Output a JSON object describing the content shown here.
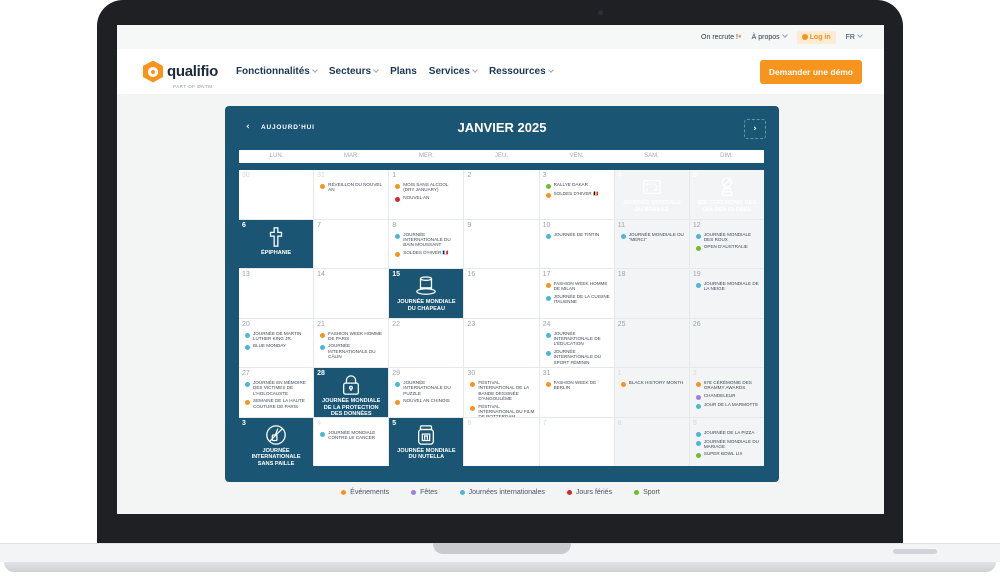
{
  "colors": {
    "evenements": "#f7941d",
    "fetes": "#9b7fe6",
    "journees": "#4ab7d8",
    "feries": "#d12b2b",
    "sport": "#6cbf2a"
  },
  "topbar": {
    "recruit": "On recrute !",
    "recruit_dot": "●",
    "about": "À propos",
    "login": "Log in",
    "lang": "FR"
  },
  "nav": {
    "logo": "qualifio",
    "logo_sub": "PART OF ØNTM",
    "items": [
      "Fonctionnalités",
      "Secteurs",
      "Plans",
      "Services",
      "Ressources"
    ],
    "cta": "Demander une démo"
  },
  "calendar": {
    "prev": "‹",
    "today": "AUJOURD'HUI",
    "month": "JANVIER 2025",
    "next": "›",
    "weekdays": [
      "LUN.",
      "MAR.",
      "MER.",
      "JEU.",
      "VEN.",
      "SAM.",
      "DIM."
    ],
    "days": [
      {
        "n": "30",
        "out": true,
        "events": []
      },
      {
        "n": "31",
        "out": true,
        "events": [
          {
            "t": "Réveillon du Nouvel An",
            "c": "evenements"
          }
        ]
      },
      {
        "n": "1",
        "events": [
          {
            "t": "Mois sans alcool (Dry January)",
            "c": "evenements"
          },
          {
            "t": "Nouvel An",
            "c": "feries"
          }
        ]
      },
      {
        "n": "2",
        "events": []
      },
      {
        "n": "3",
        "events": [
          {
            "t": "Rallye Dakar",
            "c": "sport"
          },
          {
            "t": "Soldes d'hiver 🇧🇪",
            "c": "evenements"
          }
        ]
      },
      {
        "n": "4",
        "featured": true,
        "icon": "braille-icon",
        "label": "Journée mondiale du braille"
      },
      {
        "n": "5",
        "featured": true,
        "icon": "golden-globe-icon",
        "label": "82e cérémonie des Golden Globes"
      },
      {
        "n": "6",
        "featured": true,
        "icon": "cross-icon",
        "label": "Épiphanie"
      },
      {
        "n": "7",
        "events": []
      },
      {
        "n": "8",
        "events": [
          {
            "t": "Journée internationale du bain moussant",
            "c": "journees"
          },
          {
            "t": "Soldes d'hiver 🇫🇷",
            "c": "evenements"
          }
        ]
      },
      {
        "n": "9",
        "events": []
      },
      {
        "n": "10",
        "events": [
          {
            "t": "Journée de Tintin",
            "c": "journees"
          }
        ]
      },
      {
        "n": "11",
        "events": [
          {
            "t": "Journée mondiale du \"merci\"",
            "c": "journees"
          }
        ]
      },
      {
        "n": "12",
        "events": [
          {
            "t": "Journée mondiale des roux",
            "c": "journees"
          },
          {
            "t": "Open d'Australie",
            "c": "sport"
          }
        ]
      },
      {
        "n": "13",
        "events": []
      },
      {
        "n": "14",
        "events": []
      },
      {
        "n": "15",
        "featured": true,
        "icon": "hat-icon",
        "label": "Journée mondiale du chapeau"
      },
      {
        "n": "16",
        "events": []
      },
      {
        "n": "17",
        "events": [
          {
            "t": "Fashion Week Homme de Milan",
            "c": "evenements"
          },
          {
            "t": "Journée de la cuisine italienne",
            "c": "journees"
          }
        ]
      },
      {
        "n": "18",
        "events": []
      },
      {
        "n": "19",
        "events": [
          {
            "t": "Journée mondiale de la neige",
            "c": "journees"
          }
        ]
      },
      {
        "n": "20",
        "events": [
          {
            "t": "Journée de Martin Luther King Jr.",
            "c": "journees"
          },
          {
            "t": "Blue Monday",
            "c": "journees"
          }
        ]
      },
      {
        "n": "21",
        "events": [
          {
            "t": "Fashion Week Homme de Paris",
            "c": "evenements"
          },
          {
            "t": "Journée internationale du câlin",
            "c": "journees"
          }
        ]
      },
      {
        "n": "22",
        "events": []
      },
      {
        "n": "23",
        "events": []
      },
      {
        "n": "24",
        "events": [
          {
            "t": "Journée internationale de l'éducation",
            "c": "journees"
          },
          {
            "t": "Journée internationale du sport féminin",
            "c": "journees"
          }
        ]
      },
      {
        "n": "25",
        "events": []
      },
      {
        "n": "26",
        "events": []
      },
      {
        "n": "27",
        "events": [
          {
            "t": "Journée en mémoire des victimes de l'Holocauste",
            "c": "journees"
          },
          {
            "t": "Semaine de la Haute Couture de Paris",
            "c": "evenements"
          }
        ]
      },
      {
        "n": "28",
        "featured": true,
        "icon": "padlock-icon",
        "label": "Journée mondiale de la protection des données"
      },
      {
        "n": "29",
        "events": [
          {
            "t": "Journée internationale du puzzle",
            "c": "journees"
          },
          {
            "t": "Nouvel An chinois",
            "c": "evenements"
          }
        ]
      },
      {
        "n": "30",
        "events": [
          {
            "t": "Festival international de la bande dessinée d'Angoulême",
            "c": "evenements"
          },
          {
            "t": "Festival international du film de Rotterdam",
            "c": "evenements"
          }
        ]
      },
      {
        "n": "31",
        "events": [
          {
            "t": "Fashion Week de Berlin",
            "c": "evenements"
          }
        ]
      },
      {
        "n": "1",
        "out": true,
        "events": [
          {
            "t": "Black History Month",
            "c": "evenements"
          }
        ]
      },
      {
        "n": "2",
        "out": true,
        "events": [
          {
            "t": "67e cérémonie des Grammy Awards",
            "c": "evenements"
          },
          {
            "t": "Chandeleur",
            "c": "fetes"
          },
          {
            "t": "Jour de la marmotte",
            "c": "journees"
          }
        ]
      },
      {
        "n": "3",
        "featured": true,
        "icon": "no-straw-icon",
        "label": "Journée internationale sans paille"
      },
      {
        "n": "4",
        "out": true,
        "events": [
          {
            "t": "Journée mondiale contre le cancer",
            "c": "journees"
          }
        ]
      },
      {
        "n": "5",
        "featured": true,
        "icon": "nutella-jar-icon",
        "label": "Journée mondiale du Nutella"
      },
      {
        "n": "6",
        "out": true,
        "events": []
      },
      {
        "n": "7",
        "out": true,
        "events": []
      },
      {
        "n": "8",
        "out": true,
        "events": []
      },
      {
        "n": "9",
        "out": true,
        "events": [
          {
            "t": "Journée de la pizza",
            "c": "journees"
          },
          {
            "t": "Journée mondiale du mariage",
            "c": "journees"
          },
          {
            "t": "Super Bowl LIX",
            "c": "sport"
          }
        ]
      }
    ]
  },
  "legend": [
    {
      "label": "Événements",
      "c": "evenements"
    },
    {
      "label": "Fêtes",
      "c": "fetes"
    },
    {
      "label": "Journées internationales",
      "c": "journees"
    },
    {
      "label": "Jours fériés",
      "c": "feries"
    },
    {
      "label": "Sport",
      "c": "sport"
    }
  ]
}
